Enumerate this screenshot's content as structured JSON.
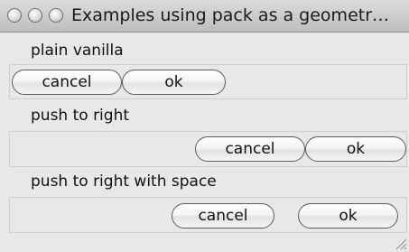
{
  "window": {
    "title": "Examples using pack as a geometr…"
  },
  "sections": [
    {
      "label": "plain vanilla",
      "cancel_label": "cancel",
      "ok_label": "ok"
    },
    {
      "label": "push to right",
      "cancel_label": "cancel",
      "ok_label": "ok"
    },
    {
      "label": "push to right with space",
      "cancel_label": "cancel",
      "ok_label": "ok"
    }
  ],
  "icons": {
    "traffic_lights": [
      "close-icon",
      "minimize-icon",
      "zoom-icon"
    ],
    "resize": "resize-grip-icon"
  }
}
